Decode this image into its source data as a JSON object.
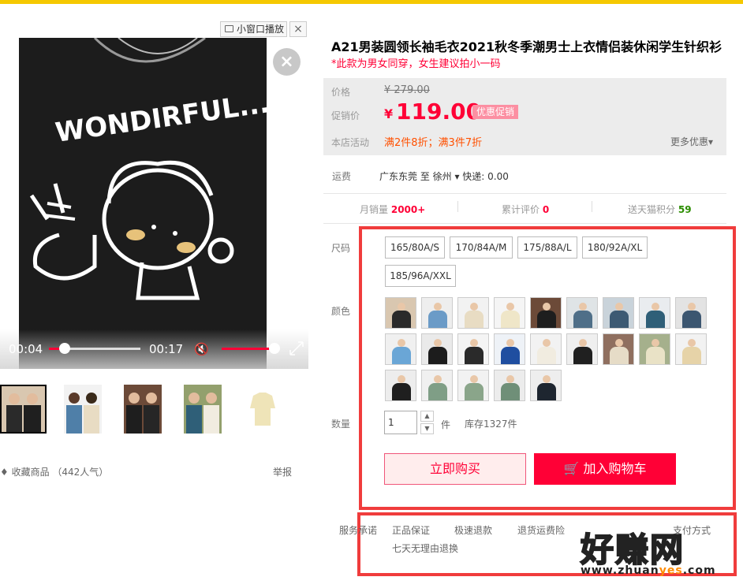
{
  "pip": {
    "label": "小窗口播放",
    "close": "×"
  },
  "video": {
    "close": "×",
    "time_current": "00:04",
    "time_total": "00:17",
    "progress": 0.17,
    "volume": 0.95,
    "graphic_text": "WONDIRFUL..."
  },
  "thumbnails": [
    "thumb-1",
    "thumb-2",
    "thumb-3",
    "thumb-4",
    "thumb-5"
  ],
  "collect": "♦ 收藏商品 （442人气）",
  "report": "举报",
  "product": {
    "title": "A21男装圆领长袖毛衣2021秋冬季潮男士上衣情侣装休闲学生针织衫",
    "subtitle": "*此款为男女同穿，女生建议拍小一码"
  },
  "price": {
    "label_price": "价格",
    "original": "¥ 279.00",
    "label_promo": "促销价",
    "currency": "¥",
    "promo": "119.00",
    "promo_tag": "优惠促销",
    "label_activity": "本店活动",
    "activity": "满2件8折；满3件7折",
    "more": "更多优惠▾"
  },
  "shipping": {
    "label": "运费",
    "value": "广东东莞  至  徐州 ▾  快递: 0.00"
  },
  "stats": {
    "monthly_label": "月销量",
    "monthly": "2000+",
    "reviews_label": "累计评价",
    "reviews": "0",
    "points_label": "送天猫积分",
    "points": "59"
  },
  "options": {
    "size_label": "尺码",
    "sizes": [
      "165/80A/S",
      "170/84A/M",
      "175/88A/L",
      "180/92A/XL",
      "185/96A/XXL"
    ],
    "color_label": "颜色",
    "qty_label": "数量",
    "qty": "1",
    "unit": "件",
    "stock": "库存1327件"
  },
  "actions": {
    "buy": "立即购买",
    "cart": "加入购物车"
  },
  "service": {
    "label": "服务承诺",
    "items": [
      "正品保证",
      "极速退款",
      "退货运费险",
      "七天无理由退换"
    ],
    "pay": "支付方式"
  },
  "watermark": {
    "title": "好赚网",
    "url_a": "www.zhuan",
    "url_b": "yes",
    "url_c": ".com"
  },
  "colors": {
    "accent": "#ff0036",
    "topbar": "#f5c800",
    "frame": "#f03c3c"
  }
}
